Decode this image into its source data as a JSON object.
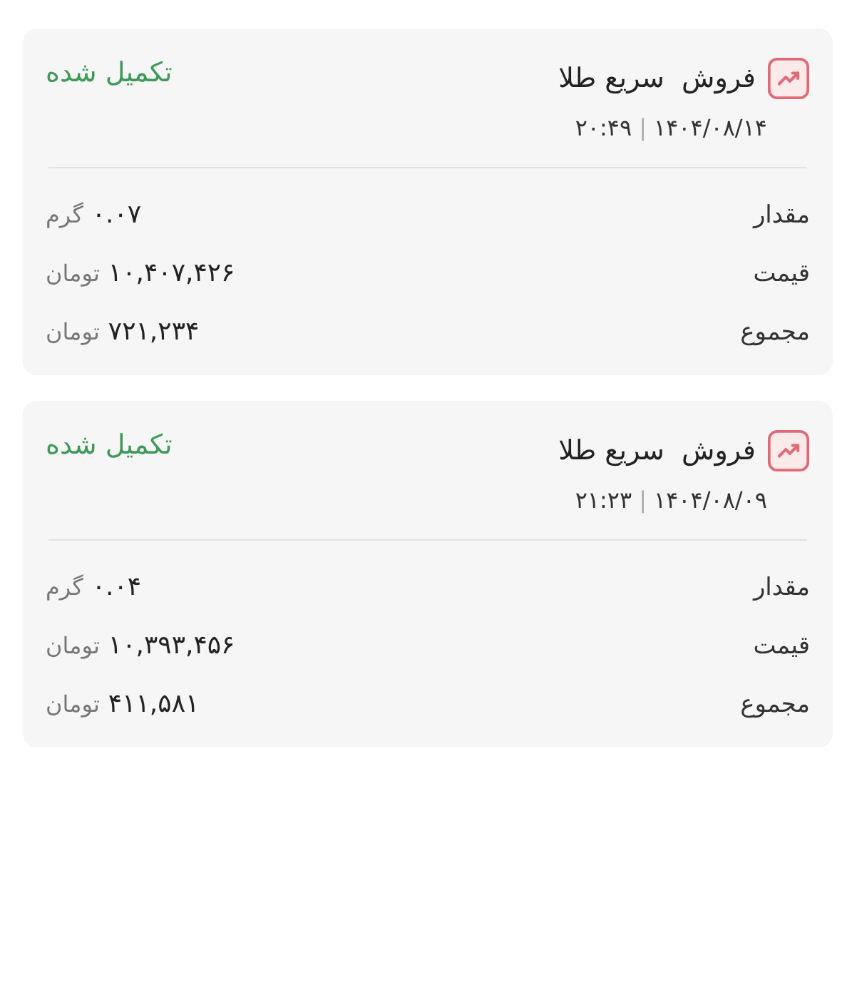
{
  "transactions": [
    {
      "title": "فروش  سریع طلا",
      "date": "۱۴۰۴/۰۸/۱۴",
      "separator": "|",
      "time": "۲۰:۴۹",
      "status": {
        "text": "تکمیل شده",
        "kind": "completed"
      },
      "rows": [
        {
          "label": "مقدار",
          "value": "۰.۰۷",
          "unit": "گرم"
        },
        {
          "label": "قیمت",
          "value": "۱۰,۴۰۷,۴۲۶",
          "unit": "تومان"
        },
        {
          "label": "مجموع",
          "value": "۷۲۱,۲۳۴",
          "unit": "تومان"
        }
      ]
    },
    {
      "title": "فروش  سریع طلا",
      "date": "۱۴۰۴/۰۸/۰۹",
      "separator": "|",
      "time": "۲۱:۲۳",
      "status": {
        "text": "تکمیل شده",
        "kind": "completed"
      },
      "rows": [
        {
          "label": "مقدار",
          "value": "۰.۰۴",
          "unit": "گرم"
        },
        {
          "label": "قیمت",
          "value": "۱۰,۳۹۳,۴۵۶",
          "unit": "تومان"
        },
        {
          "label": "مجموع",
          "value": "۴۱۱,۵۸۱",
          "unit": "تومان"
        }
      ]
    }
  ]
}
